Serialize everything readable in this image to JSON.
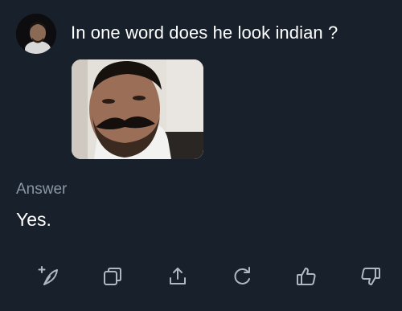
{
  "question": {
    "text": "In one word does he look indian ?",
    "avatar": "user-avatar",
    "attachment": "portrait-photo"
  },
  "answer": {
    "label": "Answer",
    "text": "Yes."
  },
  "actions": [
    {
      "name": "new-chat-icon"
    },
    {
      "name": "copy-icon"
    },
    {
      "name": "share-icon"
    },
    {
      "name": "regenerate-icon"
    },
    {
      "name": "thumbs-up-icon"
    },
    {
      "name": "thumbs-down-icon"
    }
  ],
  "colors": {
    "background": "#17202b",
    "text": "#ffffff",
    "muted": "#8a96a3",
    "icon": "#aeb8c3"
  }
}
